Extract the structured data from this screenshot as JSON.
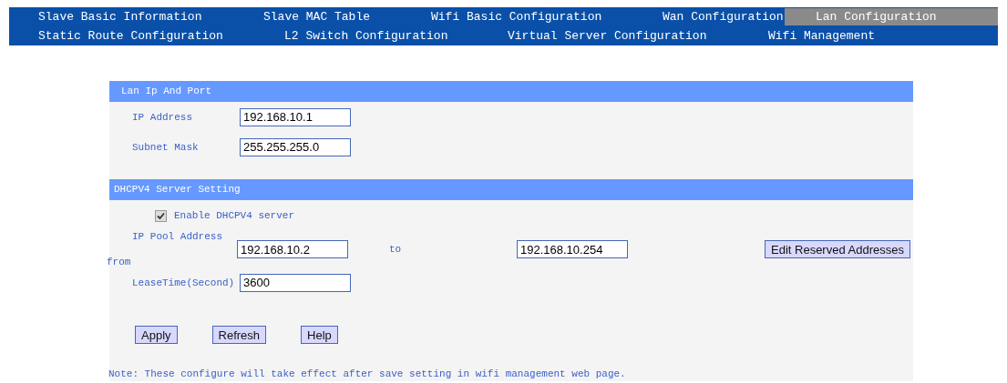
{
  "nav": [
    [
      {
        "label": "Slave Basic Information",
        "selected": false
      },
      {
        "label": "Slave MAC Table",
        "selected": false
      },
      {
        "label": "Wifi Basic Configuration",
        "selected": false
      },
      {
        "label": "Wan Configuration",
        "selected": false
      },
      {
        "label": "Lan Configuration",
        "selected": true
      }
    ],
    [
      {
        "label": "Static Route Configuration",
        "selected": false
      },
      {
        "label": "L2 Switch Configuration",
        "selected": false
      },
      {
        "label": "Virtual Server Configuration",
        "selected": false
      },
      {
        "label": "Wifi Management",
        "selected": false
      }
    ]
  ],
  "lan": {
    "title": "Lan Ip And Port",
    "ip_label": "IP Address",
    "ip": "192.168.10.1",
    "mask_label": "Subnet Mask",
    "mask": "255.255.255.0"
  },
  "dhcp": {
    "title": "DHCPV4 Server Setting",
    "enable_label": "Enable DHCPV4 server",
    "enabled": true,
    "pool_label": "IP Pool Address",
    "from_label": "from",
    "pool_start": "192.168.10.2",
    "to_label": "to",
    "pool_end": "192.168.10.254",
    "reserved_button": "Edit Reserved Addresses",
    "lease_label": "LeaseTime(Second)",
    "lease": "3600"
  },
  "buttons": [
    "Apply",
    "Refresh",
    "Help"
  ],
  "note": "Note: These configure will take effect after save setting in wifi management web page."
}
